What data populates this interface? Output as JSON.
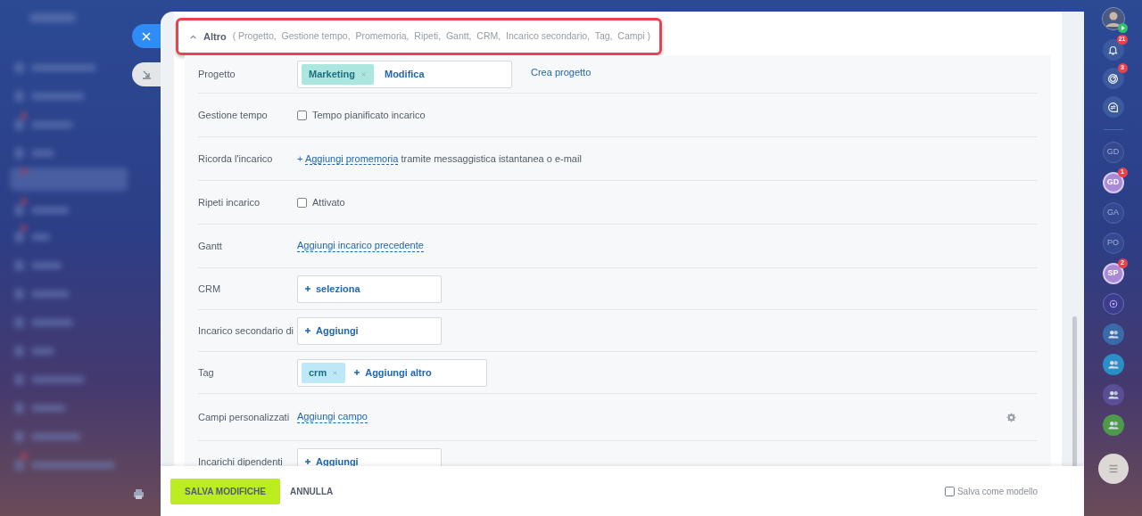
{
  "section": {
    "title": "Altro",
    "expanded": true,
    "highlighted": true,
    "summary": "( Progetto,  Gestione tempo,  Promemoria,  Ripeti,  Gantt,  CRM,  Incarico secondario,  Tag,  Campi )"
  },
  "rows": [
    {
      "label": "Progetto",
      "kind": "entity",
      "tags": [
        {
          "text": "Marketing",
          "color": "#abe6df"
        }
      ],
      "action": "Modifica",
      "plus": false,
      "extra_link": "Crea progetto"
    },
    {
      "label": "Gestione tempo",
      "kind": "checkbox",
      "checked": false,
      "text": "Tempo pianificato incarico"
    },
    {
      "label": "Ricorda l'incarico",
      "kind": "link_text",
      "prefix": "+",
      "link": "Aggiungi promemoria",
      "text": "tramite messaggistica istantanea o e-mail"
    },
    {
      "label": "Ripeti incarico",
      "kind": "checkbox",
      "checked": false,
      "text": "Attivato"
    },
    {
      "label": "Gantt",
      "kind": "link",
      "link": "Aggiungi incarico precedente"
    },
    {
      "label": "CRM",
      "kind": "entity",
      "action": "seleziona",
      "plus": true
    },
    {
      "label": "Incarico secondario di",
      "kind": "entity",
      "action": "Aggiungi",
      "plus": true
    },
    {
      "label": "Tag",
      "kind": "entity",
      "tags": [
        {
          "text": "crm",
          "color": "#bde8f8"
        }
      ],
      "action": "Aggiungi altro",
      "plus": true
    },
    {
      "label": "Campi personalizzati",
      "kind": "link",
      "link": "Aggiungi campo",
      "settings_icon": true
    },
    {
      "label": "Incarichi dipendenti",
      "kind": "entity",
      "action": "Aggiungi",
      "plus": true
    }
  ],
  "footer": {
    "save": "SALVA MODIFICHE",
    "cancel": "ANNULLA",
    "template": {
      "label": "Salva come modello",
      "checked": false
    }
  },
  "right_bar": {
    "notifications_badge": "21",
    "activity_badge": "3",
    "chats": [
      {
        "initials": "GD",
        "active": false
      },
      {
        "initials": "GD",
        "active": true,
        "badge": "1"
      },
      {
        "initials": "GA",
        "active": false
      },
      {
        "initials": "PO",
        "active": false
      },
      {
        "initials": "SP",
        "active": true,
        "badge": "2"
      }
    ],
    "groups": [
      {
        "color": "#3a6aa8"
      },
      {
        "color": "#2b8fc7"
      },
      {
        "color": "#5a4f97"
      },
      {
        "color": "#4f9a4a"
      }
    ]
  }
}
